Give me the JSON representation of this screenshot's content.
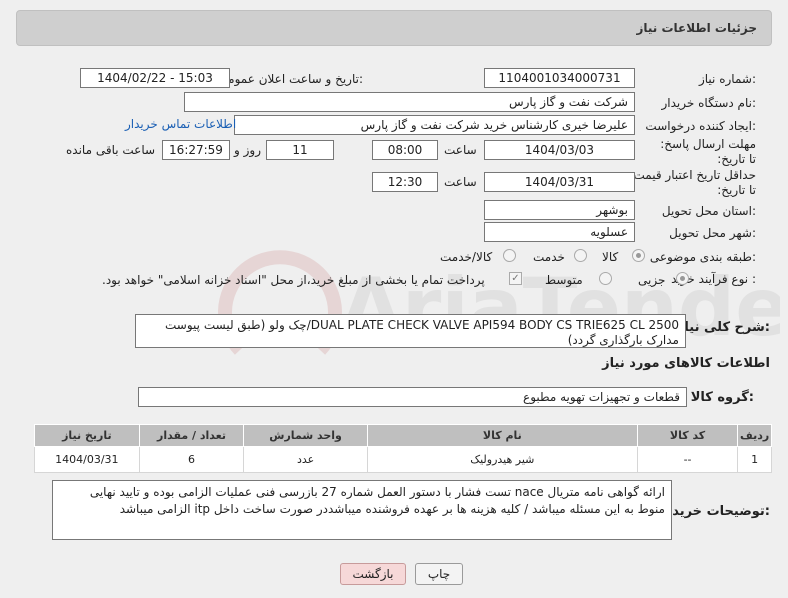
{
  "header": {
    "title": "جزئیات اطلاعات نیاز"
  },
  "form": {
    "need_number_label": "شماره نیاز:",
    "need_number": "1104001034000731",
    "announce_label": "تاریخ و ساعت اعلان عمومی:",
    "announce_value": "1404/02/22 - 15:03",
    "buyer_label": "نام دستگاه خریدار:",
    "buyer_value": "شرکت نفت و گاز پارس",
    "creator_label": "ایجاد کننده درخواست:",
    "creator_value": "علیرضا  خیری کارشناس خرید  شرکت نفت و گاز پارس",
    "contact_link": "اطلاعات تماس خریدار",
    "deadline_label": "مهلت ارسال پاسخ: تا تاریخ:",
    "deadline_date": "1404/03/03",
    "time_label": "ساعت",
    "deadline_time": "08:00",
    "days_value": "11",
    "days_label": "روز و",
    "remaining_time": "16:27:59",
    "remaining_label": "ساعت باقی مانده",
    "validity_label": "حداقل تاریخ اعتبار قیمت: تا تاریخ:",
    "validity_date": "1404/03/31",
    "validity_time": "12:30",
    "province_label": "استان محل تحویل:",
    "province_value": "بوشهر",
    "city_label": "شهر محل تحویل:",
    "city_value": "عسلویه",
    "category_label": "طبقه بندی موضوعی:",
    "category_options": [
      "کالا",
      "خدمت",
      "کالا/خدمت"
    ],
    "process_label": "نوع فرآیند خرید :",
    "process_options": [
      "جزیی",
      "متوسط"
    ],
    "payment_note": "پرداخت تمام یا بخشی از مبلغ خرید،از محل \"اسناد خزانه اسلامی\" خواهد بود."
  },
  "description": {
    "label": "شرح کلی نیاز:",
    "text": "DUAL PLATE CHECK VALVE API594 BODY CS TRIE625 CL 2500/چک ولو (طبق لیست پیوست مدارک بارگذاری گردد)"
  },
  "goods_info": {
    "title": "اطلاعات کالاهای مورد نیاز"
  },
  "goods_group": {
    "label": "گروه کالا:",
    "value": "قطعات و تجهیزات تهویه مطبوع"
  },
  "items_table": {
    "headers": [
      "ردیف",
      "کد کالا",
      "نام کالا",
      "واحد شمارش",
      "تعداد / مقدار",
      "تاریخ نیاز"
    ],
    "rows": [
      [
        "1",
        "--",
        "شیر هیدرولیک",
        "عدد",
        "6",
        "1404/03/31"
      ]
    ]
  },
  "buyer_notes": {
    "label": "توضیحات خریدار:",
    "text": "ارائه گواهی نامه متریال nace  تست فشار با دستور العمل شماره 27 بازرسی فنی عملیات الزامی بوده و تایید نهایی منوط به این مسئله میباشد / کلیه هزینه ها بر عهده فروشنده میباشددر صورت ساخت داخل itp  الزامی میباشد"
  },
  "buttons": {
    "print": "چاپ",
    "back": "بازگشت"
  },
  "watermark": {
    "text": "AriaTender.neT"
  },
  "colors": {
    "header_bg": "#cfcfcf",
    "link": "#1a5fb4",
    "back_button_bg": "#f6d8d8"
  }
}
